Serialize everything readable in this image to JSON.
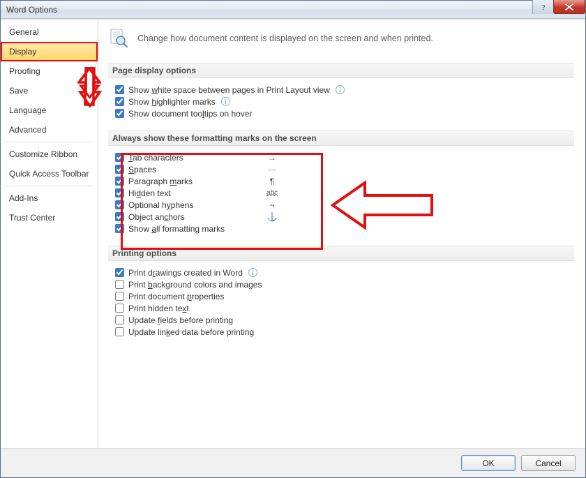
{
  "window": {
    "title": "Word Options"
  },
  "sidebar": {
    "items": [
      {
        "label": "General"
      },
      {
        "label": "Display"
      },
      {
        "label": "Proofing"
      },
      {
        "label": "Save"
      },
      {
        "label": "Language"
      },
      {
        "label": "Advanced"
      },
      {
        "label": "Customize Ribbon"
      },
      {
        "label": "Quick Access Toolbar"
      },
      {
        "label": "Add-Ins"
      },
      {
        "label": "Trust Center"
      }
    ]
  },
  "header": {
    "text": "Change how document content is displayed on the screen and when printed."
  },
  "sections": {
    "page_display": {
      "title": "Page display options",
      "white_space_pre": "Show ",
      "white_space_u": "w",
      "white_space_post": "hite space between pages in Print Layout view",
      "highlighter_pre": "Show ",
      "highlighter_u": "h",
      "highlighter_post": "ighlighter marks",
      "tooltips_pre": "Show document too",
      "tooltips_u": "l",
      "tooltips_post": "tips on hover"
    },
    "formatting": {
      "title": "Always show these formatting marks on the screen",
      "tab_u": "T",
      "tab_post": "ab characters",
      "tab_sym": "→",
      "spaces_u": "S",
      "spaces_post": "paces",
      "spaces_sym": "···",
      "para_pre": "Paragraph ",
      "para_u": "m",
      "para_post": "arks",
      "para_sym": "¶",
      "hidden_pre": "",
      "hidden_pre2": "Hi",
      "hidden_u": "d",
      "hidden_post": "den text",
      "hidden_sym": "a͟b͟c͟",
      "hyphens_pre": "Optional h",
      "hyphens_u": "y",
      "hyphens_post": "phens",
      "hyphens_sym": "¬",
      "anchors_pre": "Object an",
      "anchors_u": "c",
      "anchors_post": "hors",
      "anchors_sym": "⚓",
      "showall_pre": "Show ",
      "showall_u": "a",
      "showall_post": "ll formatting marks"
    },
    "printing": {
      "title": "Printing options",
      "drawings_pre": "Print d",
      "drawings_u": "r",
      "drawings_post": "awings created in Word",
      "bg_pre": "Print ",
      "bg_u": "b",
      "bg_post": "ackground colors and images",
      "props_pre": "Print document ",
      "props_u": "p",
      "props_post": "roperties",
      "hidden_pre": "Print hidden te",
      "hidden_u": "x",
      "hidden_post": "t",
      "fields_pre": "Update ",
      "fields_u": "f",
      "fields_post": "ields before printing",
      "linked_pre": "Update lin",
      "linked_u": "k",
      "linked_post": "ed data before printing"
    }
  },
  "buttons": {
    "ok": "OK",
    "cancel": "Cancel"
  }
}
